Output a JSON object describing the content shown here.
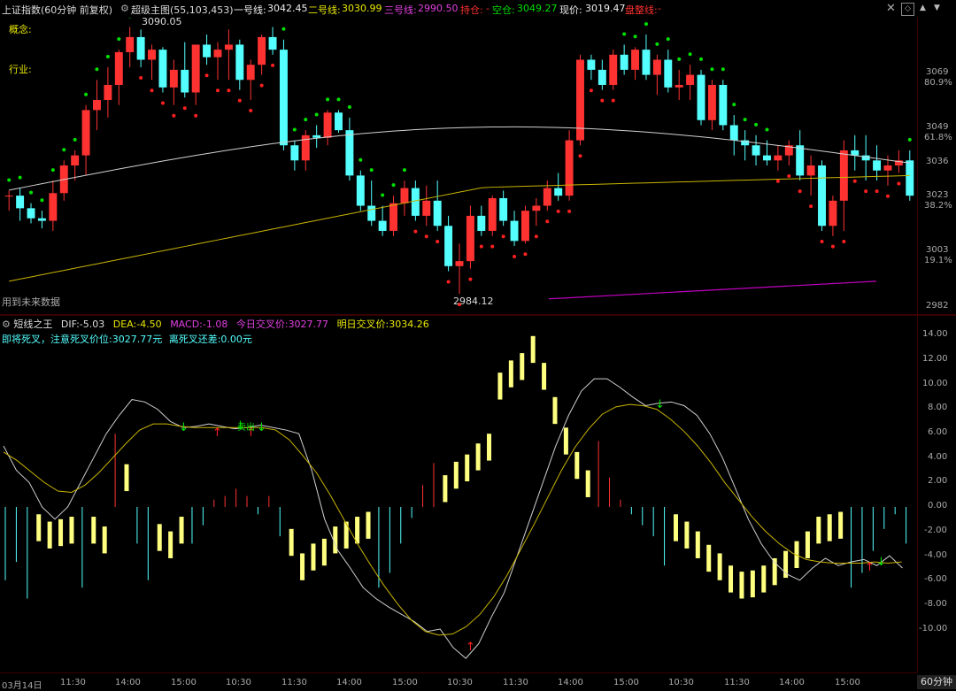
{
  "header": {
    "title": "上证指数(60分钟 前复权)",
    "indicator_name": "超级主图(55,103,453)",
    "line1_label": "一号线:",
    "line1_value": "3042.45",
    "line2_label": "二号线:",
    "line2_value": "3030.99",
    "line3_label": "三号线:",
    "line3_value": "2990.50",
    "hold_label": "持仓:",
    "hold_value": "-",
    "empty_label": "空仓:",
    "empty_value": "3049.27",
    "price_label": "现价:",
    "price_value": "3019.47",
    "stop_label": "盘整线:",
    "stop_value": "-"
  },
  "main": {
    "left_labels": [
      "概念:",
      "行业:"
    ],
    "note": "用到未来数据",
    "high_label": "3090.05",
    "low_label": "2984.12",
    "y_axis": [
      {
        "price": "3069",
        "pct": "80.9%"
      },
      {
        "price": "3049",
        "pct": "61.8%"
      },
      {
        "price": "3036",
        "pct": ""
      },
      {
        "price": "3023",
        "pct": "38.2%"
      },
      {
        "price": "3003",
        "pct": "19.1%"
      },
      {
        "price": "2982",
        "pct": ""
      }
    ]
  },
  "macd": {
    "name": "短线之王",
    "dif_label": "DIF:",
    "dif_value": "-5.03",
    "dea_label": "DEA:",
    "dea_value": "-4.50",
    "macd_label": "MACD:",
    "macd_value": "-1.08",
    "today_label": "今日交叉价:",
    "today_value": "3027.77",
    "tomorrow_label": "明日交叉价:",
    "tomorrow_value": "3034.26",
    "status_text": "即将死叉，注意死叉价位:3027.77元",
    "gap_text": "离死叉还差:0.00元",
    "sell_text": "卖出",
    "y_axis": [
      "14.00",
      "12.00",
      "10.00",
      "8.00",
      "6.00",
      "4.00",
      "2.00",
      "0.00",
      "-2.00",
      "-4.00",
      "-6.00",
      "-8.00",
      "-10.00"
    ]
  },
  "timeline": {
    "labels": [
      "03月14日",
      "11:30",
      "14:00",
      "15:00",
      "10:30",
      "11:30",
      "14:00",
      "15:00",
      "10:30",
      "11:30",
      "14:00",
      "15:00",
      "10:30",
      "11:30",
      "14:00",
      "15:00"
    ],
    "period": "60分钟"
  },
  "colors": {
    "up": "#ff3232",
    "down": "#54ffff",
    "yellow_bar": "#ffff80",
    "ma_white": "#d0d0d0",
    "ma_yellow": "#c8b400",
    "ma_magenta": "#c000c0",
    "dot_green": "#00e000",
    "dot_red": "#ff2020"
  },
  "candles": [
    [
      3024,
      3026,
      3018,
      3024
    ],
    [
      3024,
      3027,
      3014,
      3019
    ],
    [
      3019,
      3021,
      3013,
      3015
    ],
    [
      3015,
      3018,
      3011,
      3014
    ],
    [
      3014,
      3030,
      3010,
      3025
    ],
    [
      3025,
      3038,
      3022,
      3036
    ],
    [
      3036,
      3042,
      3030,
      3040
    ],
    [
      3040,
      3060,
      3032,
      3058
    ],
    [
      3058,
      3070,
      3050,
      3062
    ],
    [
      3062,
      3075,
      3055,
      3068
    ],
    [
      3068,
      3082,
      3060,
      3081
    ],
    [
      3081,
      3091,
      3075,
      3087
    ],
    [
      3087,
      3090,
      3075,
      3078
    ],
    [
      3078,
      3084,
      3070,
      3082
    ],
    [
      3082,
      3083,
      3065,
      3067
    ],
    [
      3067,
      3078,
      3060,
      3074
    ],
    [
      3074,
      3085,
      3063,
      3065
    ],
    [
      3065,
      3083,
      3060,
      3084
    ],
    [
      3084,
      3088,
      3076,
      3079
    ],
    [
      3079,
      3085,
      3070,
      3082
    ],
    [
      3082,
      3090,
      3070,
      3084
    ],
    [
      3084,
      3086,
      3066,
      3070
    ],
    [
      3070,
      3078,
      3062,
      3076
    ],
    [
      3076,
      3088,
      3072,
      3087
    ],
    [
      3087,
      3091,
      3080,
      3082
    ],
    [
      3082,
      3086,
      3042,
      3044
    ],
    [
      3044,
      3046,
      3034,
      3038
    ],
    [
      3038,
      3050,
      3034,
      3048
    ],
    [
      3048,
      3052,
      3043,
      3047
    ],
    [
      3047,
      3058,
      3044,
      3057
    ],
    [
      3057,
      3058,
      3049,
      3050
    ],
    [
      3050,
      3055,
      3030,
      3032
    ],
    [
      3032,
      3034,
      3018,
      3020
    ],
    [
      3020,
      3030,
      3012,
      3014
    ],
    [
      3014,
      3020,
      3008,
      3010
    ],
    [
      3010,
      3024,
      3008,
      3021
    ],
    [
      3021,
      3030,
      3016,
      3027
    ],
    [
      3027,
      3030,
      3014,
      3016
    ],
    [
      3016,
      3028,
      3012,
      3022
    ],
    [
      3022,
      3030,
      3010,
      3012
    ],
    [
      3012,
      3016,
      2994,
      2996
    ],
    [
      2996,
      3005,
      2985,
      2998
    ],
    [
      2998,
      3020,
      2995,
      3016
    ],
    [
      3016,
      3020,
      3008,
      3010
    ],
    [
      3010,
      3024,
      3008,
      3023
    ],
    [
      3023,
      3026,
      3012,
      3014
    ],
    [
      3014,
      3018,
      3004,
      3006
    ],
    [
      3006,
      3020,
      3005,
      3018
    ],
    [
      3018,
      3023,
      3012,
      3020
    ],
    [
      3020,
      3030,
      3018,
      3027
    ],
    [
      3027,
      3033,
      3022,
      3024
    ],
    [
      3024,
      3050,
      3022,
      3046
    ],
    [
      3046,
      3080,
      3044,
      3078
    ],
    [
      3078,
      3080,
      3070,
      3074
    ],
    [
      3074,
      3078,
      3066,
      3068
    ],
    [
      3068,
      3082,
      3066,
      3080
    ],
    [
      3080,
      3084,
      3072,
      3074
    ],
    [
      3074,
      3083,
      3070,
      3082
    ],
    [
      3082,
      3088,
      3070,
      3072
    ],
    [
      3072,
      3080,
      3064,
      3078
    ],
    [
      3078,
      3082,
      3065,
      3067
    ],
    [
      3067,
      3074,
      3062,
      3068
    ],
    [
      3068,
      3076,
      3062,
      3072
    ],
    [
      3072,
      3074,
      3052,
      3054
    ],
    [
      3054,
      3070,
      3050,
      3068
    ],
    [
      3068,
      3070,
      3050,
      3052
    ],
    [
      3052,
      3056,
      3040,
      3046
    ],
    [
      3046,
      3050,
      3038,
      3044
    ],
    [
      3044,
      3048,
      3036,
      3040
    ],
    [
      3040,
      3046,
      3036,
      3038
    ],
    [
      3038,
      3044,
      3034,
      3040
    ],
    [
      3040,
      3046,
      3036,
      3044
    ],
    [
      3044,
      3050,
      3030,
      3032
    ],
    [
      3032,
      3040,
      3024,
      3036
    ],
    [
      3036,
      3038,
      3010,
      3012
    ],
    [
      3012,
      3024,
      3008,
      3022
    ],
    [
      3022,
      3046,
      3010,
      3042
    ],
    [
      3042,
      3048,
      3034,
      3040
    ],
    [
      3040,
      3048,
      3030,
      3038
    ],
    [
      3038,
      3044,
      3030,
      3034
    ],
    [
      3034,
      3040,
      3028,
      3036
    ],
    [
      3036,
      3042,
      3033,
      3038
    ],
    [
      3038,
      3042,
      3022,
      3024
    ]
  ],
  "macd_bars": [
    -2.0,
    -1.5,
    -2.5,
    -2.8,
    -3.4,
    -3.2,
    -3.0,
    -2.2,
    -3.0,
    -3.8,
    2.0,
    3.5,
    -1.0,
    -2.0,
    -3.6,
    -4.2,
    -3.0,
    -1.0,
    -0.5,
    0.2,
    0.3,
    0.5,
    0.3,
    -0.2,
    0.3,
    -0.8,
    -4.0,
    -6.0,
    -5.2,
    -4.8,
    -3.8,
    -3.4,
    -3.0,
    -2.6,
    -2.2,
    -1.8,
    -1.0,
    -0.3,
    0.6,
    1.2,
    2.6,
    3.7,
    4.3,
    5.2,
    6.0,
    11.0,
    12.0,
    12.6,
    14.0,
    11.8,
    9.0,
    6.5,
    4.5,
    3.0,
    1.8,
    0.8,
    0.2,
    -0.2,
    -0.5,
    -0.8,
    -1.6,
    -2.8,
    -3.4,
    -4.2,
    -5.3,
    -6.0,
    -7.0,
    -7.5,
    -7.4,
    -7.0,
    -6.4,
    -5.8,
    -5.0,
    -4.2,
    -3.0,
    -2.8,
    -2.6,
    -2.2,
    -1.8,
    -1.2,
    -0.6,
    -0.2,
    -1.0
  ],
  "dif": [
    5,
    3,
    2,
    0,
    -1,
    0,
    2,
    4,
    6,
    7.5,
    8.8,
    8.6,
    8.0,
    7.0,
    6.5,
    6.6,
    6.8,
    6.6,
    6.4,
    6.5,
    6.7,
    6.5,
    6.3,
    6.0,
    3.0,
    -1.0,
    -3.5,
    -5.0,
    -6.6,
    -7.5,
    -8.2,
    -8.8,
    -9.4,
    -10.2,
    -10.0,
    -11.5,
    -12.4,
    -11.2,
    -9.0,
    -7.0,
    -4.0,
    -1.0,
    2.0,
    5.0,
    7.5,
    9.5,
    10.5,
    10.5,
    9.8,
    9.0,
    8.3,
    8.5,
    8.6,
    8.3,
    7.5,
    6.0,
    4.0,
    1.5,
    -1.0,
    -3.0,
    -4.5,
    -5.5,
    -6.0,
    -5.0,
    -4.2,
    -4.8,
    -4.5,
    -4.3,
    -4.8,
    -4.0,
    -5.0
  ],
  "dea": [
    4.5,
    3.8,
    2.9,
    2.0,
    1.3,
    1.2,
    1.8,
    2.8,
    4.0,
    5.2,
    6.3,
    6.8,
    6.8,
    6.6,
    6.5,
    6.5,
    6.5,
    6.5,
    6.5,
    6.5,
    6.3,
    5.5,
    4.2,
    2.8,
    1.0,
    -1.0,
    -3.0,
    -4.8,
    -6.5,
    -8.0,
    -9.3,
    -10.2,
    -10.5,
    -10.4,
    -9.8,
    -8.8,
    -7.4,
    -5.6,
    -3.5,
    -1.4,
    0.8,
    3.0,
    4.9,
    6.4,
    7.6,
    8.2,
    8.4,
    8.3,
    8.0,
    7.2,
    6.2,
    5.0,
    3.6,
    2.0,
    0.6,
    -0.8,
    -2.0,
    -3.0,
    -3.8,
    -4.3,
    -4.5,
    -4.6,
    -4.6,
    -4.6,
    -4.5,
    -4.6,
    -4.5
  ]
}
